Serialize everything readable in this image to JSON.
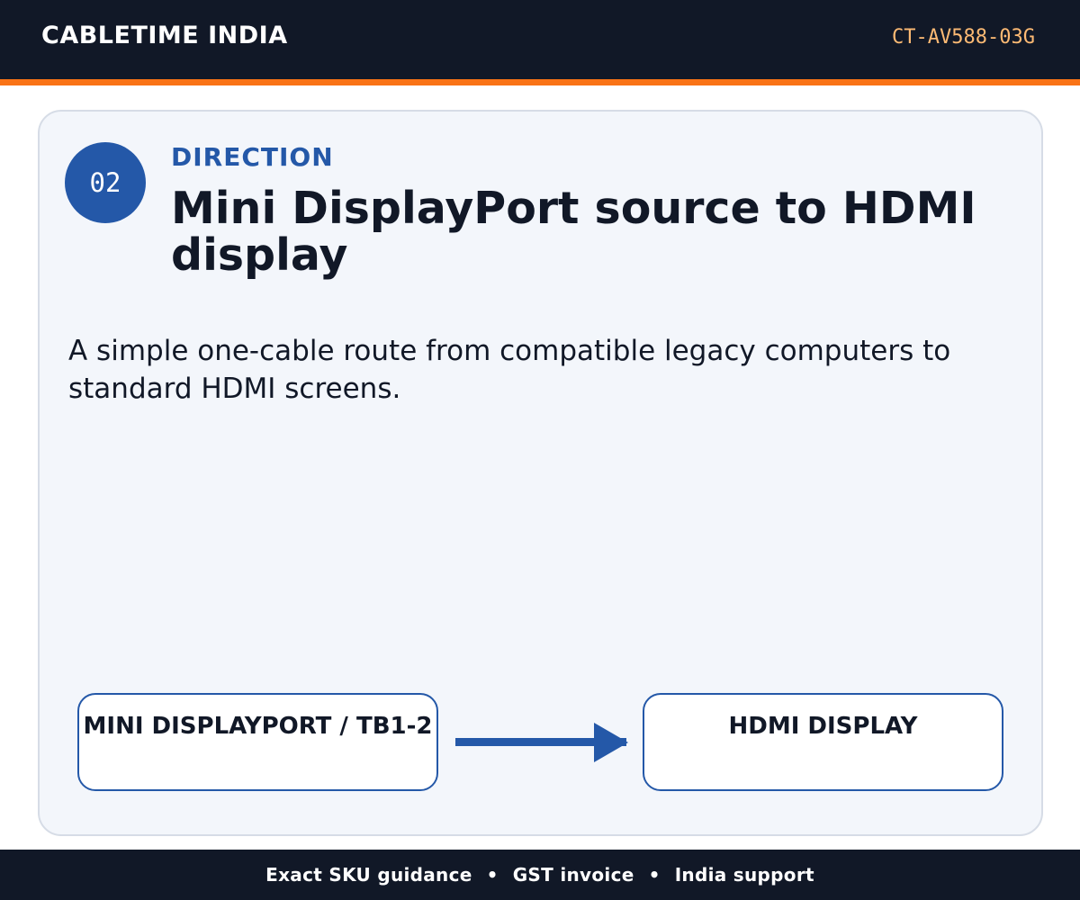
{
  "header": {
    "brand": "CABLETIME INDIA",
    "sku": "CT-AV588-03G"
  },
  "card": {
    "step_number": "02",
    "eyebrow": "DIRECTION",
    "title": "Mini DisplayPort source to HDMI display",
    "description": "A simple one-cable route from compatible legacy computers to standard HDMI screens.",
    "flow": {
      "source_label": "MINI DISPLAYPORT / TB1-2",
      "target_label": "HDMI DISPLAY"
    }
  },
  "footer": {
    "items": [
      "Exact SKU guidance",
      "GST invoice",
      "India support"
    ],
    "separator": "•"
  },
  "colors": {
    "header_bg": "#111827",
    "accent": "#f97316",
    "primary_blue": "#2458a8",
    "card_bg": "#f3f6fb",
    "sku_text": "#fdba74"
  },
  "icons": {
    "flow_arrow": "arrow-right-icon"
  }
}
